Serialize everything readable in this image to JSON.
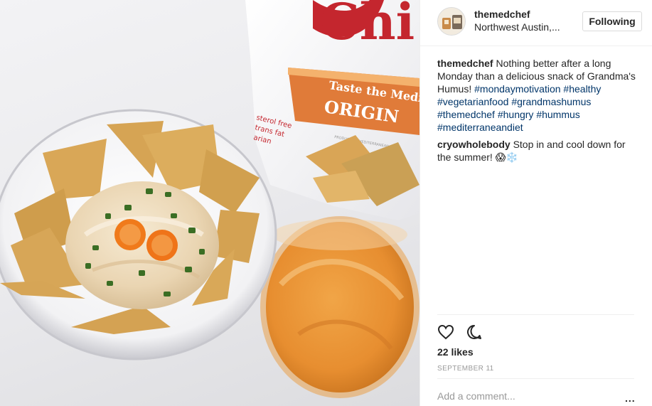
{
  "post": {
    "username": "themedchef",
    "location": "Northwest Austin,...",
    "follow_label": "Following",
    "likes_text": "22 likes",
    "date_text": "SEPTEMBER 11",
    "add_comment_placeholder": "Add a comment...",
    "more_label": "..."
  },
  "comments": [
    {
      "user": "themedchef",
      "text": " Nothing better after a long Monday than a delicious snack of Grandma's Humus! ",
      "hashtags": [
        "#mondaymotivation",
        "#healthy",
        "#vegetarianfood",
        "#grandmashumus",
        "#themedchef",
        "#hungry",
        "#hummus",
        "#mediterraneandiet"
      ]
    },
    {
      "user": "cryowholebody",
      "text": " Stop in and cool down for the summer! 😱❄️"
    }
  ],
  "photo": {
    "bag_brand": "Chi",
    "bag_tagline": "Taste the Medit",
    "bag_flavor": "ORIGIN",
    "bag_side_text": [
      "sterol free",
      "trans fat",
      "arian"
    ],
    "bag_small_text": "PRODUCT OF MEDITERRANEAN"
  },
  "icons": {
    "like": "heart-icon",
    "comment": "speech-bubble-icon",
    "more": "ellipsis-icon"
  },
  "colors": {
    "link": "#003569",
    "brand_red": "#c4262e",
    "bag_orange": "#e07b39"
  }
}
